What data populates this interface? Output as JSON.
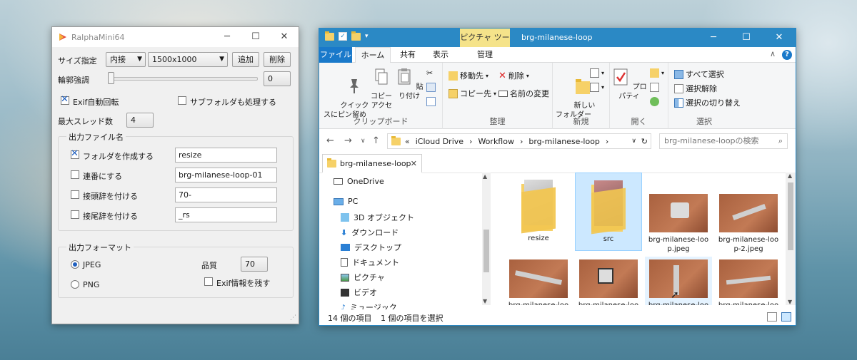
{
  "ralpha": {
    "title": "RalphaMini64",
    "size_label": "サイズ指定",
    "size_mode": "内接",
    "size_value": "1500x1000",
    "add_button": "追加",
    "delete_button": "削除",
    "sharpen_label": "輪郭強調",
    "sharpen_value": "0",
    "exif_rotate_label": "Exif自動回転",
    "subfolder_label": "サブフォルダも処理する",
    "max_threads_label": "最大スレッド数",
    "max_threads_value": "4",
    "output_name_group": "出力ファイル名",
    "create_folder_label": "フォルダを作成する",
    "create_folder_value": "resize",
    "serial_label": "連番にする",
    "serial_value": "brg-milanese-loop-01",
    "prefix_label": "接頭辞を付ける",
    "prefix_value": "70-",
    "suffix_label": "接尾辞を付ける",
    "suffix_value": "_rs",
    "format_group": "出力フォーマット",
    "jpeg_label": "JPEG",
    "png_label": "PNG",
    "quality_label": "品質",
    "quality_value": "70",
    "keep_exif_label": "Exif情報を残す"
  },
  "explorer": {
    "tool_tab": "ピクチャ ツール",
    "title": "brg-milanese-loop",
    "tabs": {
      "file": "ファイル",
      "home": "ホーム",
      "share": "共有",
      "view": "表示",
      "manage": "管理"
    },
    "ribbon": {
      "pin": "クイック アクセ\nスにピン留め",
      "copy": "コピー",
      "paste": "貼り付け",
      "clipboard": "クリップボード",
      "move_to": "移動先",
      "copy_to": "コピー先",
      "delete": "削除",
      "rename": "名前の変更",
      "organize": "整理",
      "new_folder": "新しい\nフォルダー",
      "new": "新規",
      "properties": "プロパティ",
      "open": "開く",
      "select_all": "すべて選択",
      "select_none": "選択解除",
      "invert": "選択の切り替え",
      "select": "選択"
    },
    "address": {
      "prefix": "«",
      "parts": [
        "iCloud Drive",
        "Workflow",
        "brg-milanese-loop"
      ]
    },
    "search_placeholder": "brg-milanese-loopの検索",
    "doc_tab": "brg-milanese-loop",
    "nav": [
      "OneDrive",
      "PC",
      "3D オブジェクト",
      "ダウンロード",
      "デスクトップ",
      "ドキュメント",
      "ピクチャ",
      "ビデオ",
      "ミュージック"
    ],
    "files": [
      {
        "name": "resize",
        "kind": "folder"
      },
      {
        "name": "src",
        "kind": "folder"
      },
      {
        "name": "brg-milanese-loo\np.jpeg",
        "kind": "image"
      },
      {
        "name": "brg-milanese-loo\np-2.jpeg",
        "kind": "image"
      },
      {
        "name": "brg-milanese-loo",
        "kind": "image"
      },
      {
        "name": "brg-milanese-loo",
        "kind": "image"
      },
      {
        "name": "brg-milanese-loo",
        "kind": "image"
      },
      {
        "name": "brg-milanese-loo",
        "kind": "image"
      }
    ],
    "status_count": "14 個の項目",
    "status_selected": "1 個の項目を選択"
  },
  "colors": {
    "accent": "#2b89c5",
    "file_tab": "#1979ca",
    "tool_tab": "#f5e38a",
    "folder": "#f6d168",
    "selection": "#cce8ff"
  }
}
